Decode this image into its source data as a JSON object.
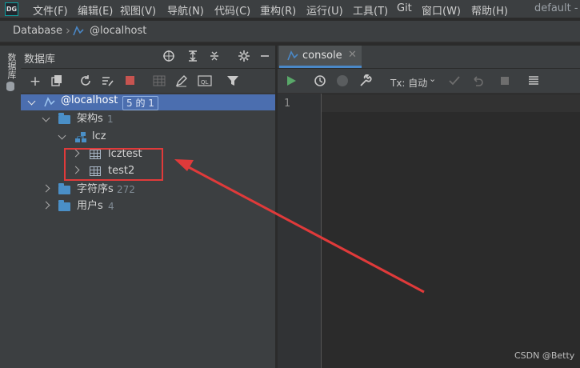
{
  "app_logo": "DG",
  "menu": [
    "文件(F)",
    "编辑(E)",
    "视图(V)",
    "导航(N)",
    "代码(C)",
    "重构(R)",
    "运行(U)",
    "工具(T)",
    "Git",
    "窗口(W)",
    "帮助(H)"
  ],
  "window_title": "default - c",
  "breadcrumb": {
    "root": "Database",
    "host": "@localhost"
  },
  "side_strip": {
    "label": "数据库"
  },
  "db_panel": {
    "title": "数据库",
    "tree": {
      "host": {
        "label": "@localhost",
        "badge": "5 的 1"
      },
      "schemas": {
        "label": "架构s",
        "count": "1"
      },
      "schema_lcz": {
        "label": "lcz"
      },
      "tables": [
        {
          "label": "lcztest"
        },
        {
          "label": "test2"
        }
      ],
      "collations": {
        "label": "字符序s",
        "count": "272"
      },
      "users": {
        "label": "用户s",
        "count": "4"
      }
    }
  },
  "console": {
    "tab_label": "console",
    "tx_label": "Tx: 自动",
    "line_number": "1"
  },
  "colors": {
    "accent": "#4b6eaf",
    "run": "#59a869",
    "stop": "#c75450",
    "annotation": "#e03a3a"
  },
  "watermark": "CSDN @Betty"
}
